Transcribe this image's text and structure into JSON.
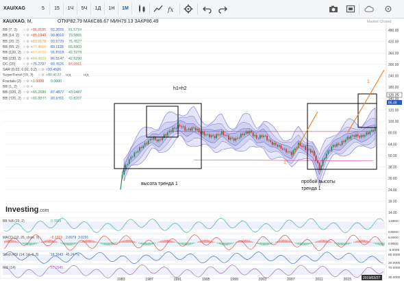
{
  "toolbar": {
    "symbol": "XAU/XAG",
    "intervals": [
      "5",
      "15",
      "1Ч",
      "5Ч",
      "1Д",
      "1Н",
      "1М"
    ],
    "active_interval": "1М",
    "icons": [
      "candles-icon",
      "bar-chart-icon",
      "compare-icon",
      "fx-icon",
      "crosshair-icon",
      "gear-icon",
      "undo-icon",
      "redo-icon",
      "camera-icon",
      "fullscreen-icon",
      "cloud-icon",
      "settings-icon"
    ]
  },
  "header": {
    "title": "XAU/XAG",
    "interval": "M",
    "ohlc": "ОТКР82.79  МАКС86.67  МИН79.13  ЗАКР86.49",
    "market_status": "Market Closed"
  },
  "indicators": [
    {
      "name": "BB (7, 2)",
      "values": [
        "86.9195",
        "92.2655",
        "81.5734"
      ],
      "colors": [
        "#d33a2c",
        "#2a58b8",
        "#2e8b57"
      ]
    },
    {
      "name": "BB (14, 2)",
      "values": [
        "85.1940",
        "90.8016",
        "79.5865"
      ],
      "colors": [
        "#d33a2c",
        "#2a58b8",
        "#2e8b57"
      ]
    },
    {
      "name": "BB (20, 2)",
      "values": [
        "83.5178",
        "90.5729",
        "76.4627"
      ],
      "colors": [
        "#e08a2b",
        "#2a58b8",
        "#2e8b57"
      ]
    },
    {
      "name": "BB (55, 2)",
      "values": [
        "77.4616",
        "89.1128",
        "65.6903"
      ],
      "colors": [
        "#e8a23a",
        "#2a58b8",
        "#2e8b57"
      ]
    },
    {
      "name": "BB (120, 2)",
      "values": [
        "67.4596",
        "91.8318",
        "42.3278"
      ],
      "colors": [
        "#e8c03a",
        "#2a58b8",
        "#2e8b57"
      ]
    },
    {
      "name": "BB (230, 2)",
      "values": [
        "64.4609",
        "86.5147",
        "42.6290"
      ],
      "colors": [
        "#9bc43a",
        "#2a58b8",
        "#2e8b57"
      ]
    },
    {
      "name": "DC (20)",
      "values": [
        "75.2797",
        "93.4526",
        "84.0661"
      ],
      "colors": [
        "#2a58b8",
        "#2a58b8",
        "#d33a2c"
      ]
    },
    {
      "name": "SAR (0.02, 0.02, 0.2)",
      "values": [
        "93.4526"
      ],
      "colors": [
        "#2a58b8"
      ]
    },
    {
      "name": "SuperTrend (10, 3)",
      "values": [
        "80.4122",
        "н/д",
        "н/д"
      ],
      "colors": [
        "#2e8b57",
        "#555555",
        "#555555"
      ]
    },
    {
      "name": "Fractals (2)",
      "values": [
        "1.0000",
        "0.0000"
      ],
      "colors": [
        "#d33a2c",
        "#2e8b57"
      ]
    },
    {
      "name": "BB (1, 2)",
      "values": [
        "",
        "",
        ""
      ],
      "colors": [
        "#2a58b8",
        "#2a58b8",
        "#2a58b8"
      ]
    },
    {
      "name": "BB (320, 2)",
      "values": [
        "65.2680",
        "87.4877",
        "43.0487"
      ],
      "colors": [
        "#2e8b57",
        "#2a58b8",
        "#2e8b57"
      ]
    },
    {
      "name": "BB (420, 2)",
      "values": [
        "66.8844",
        "90.9461",
        "42.8207"
      ],
      "colors": [
        "#2e8b57",
        "#2a58b8",
        "#2e8b57"
      ]
    }
  ],
  "annotations": {
    "h_label": "h1=h2",
    "trend_height": "высота тренда 1",
    "breakout_line1": "пробой высоты",
    "breakout_line2": "тренда 1",
    "mark_1": "1",
    "mark_1pp": "1''"
  },
  "price_axis": {
    "ticks": [
      "480.00",
      "420.00",
      "360.00",
      "300.00",
      "240.00",
      "180.00",
      "140.00",
      "120.00",
      "100.00",
      "80.00",
      "64.00",
      "50.00",
      "38.00",
      "30.00",
      "24.00",
      "18.00",
      "14.00"
    ],
    "last_price": "86.49",
    "price_tag_upper": "120.25",
    "price_tag_lower": "86.49"
  },
  "subpanels": [
    {
      "label": "BB %B (20, 2)",
      "value": "0.7899",
      "axis": [
        "1.0000",
        "0.0000"
      ],
      "color": "#2aa39a"
    },
    {
      "label": "MACD (12, 26, close, 9)",
      "value": "-0.1313",
      "extra": [
        "2.8979",
        "3.0291"
      ],
      "axis": [
        "5.0000",
        "0.0000",
        "-5.0000"
      ],
      "color": "#d33a2c"
    },
    {
      "label": "Stoch RSI (14, 14, 3, 3)",
      "value": "18.1643",
      "extra": [
        "45.247%"
      ],
      "axis": [
        "80.0000",
        "20.0000"
      ],
      "color": "#2a58b8"
    },
    {
      "label": "RSI (14)",
      "value": "57.2945",
      "axis": [
        "70.0000",
        "30.0000"
      ],
      "color": "#9b59b6"
    }
  ],
  "time_axis": [
    "1983",
    "1987",
    "1991",
    "1995",
    "1999",
    "2003",
    "2007",
    "2011",
    "2015",
    "2019/03/27"
  ],
  "logo": {
    "name": "Investing",
    "domain": ".com"
  },
  "colors": {
    "candle_up": "#2e8b57",
    "candle_down": "#d33a2c",
    "band_fill": "#cfd2f0",
    "band_line": "#7b6fd6",
    "trend_line": "#f07a1a",
    "box": "#000000"
  }
}
